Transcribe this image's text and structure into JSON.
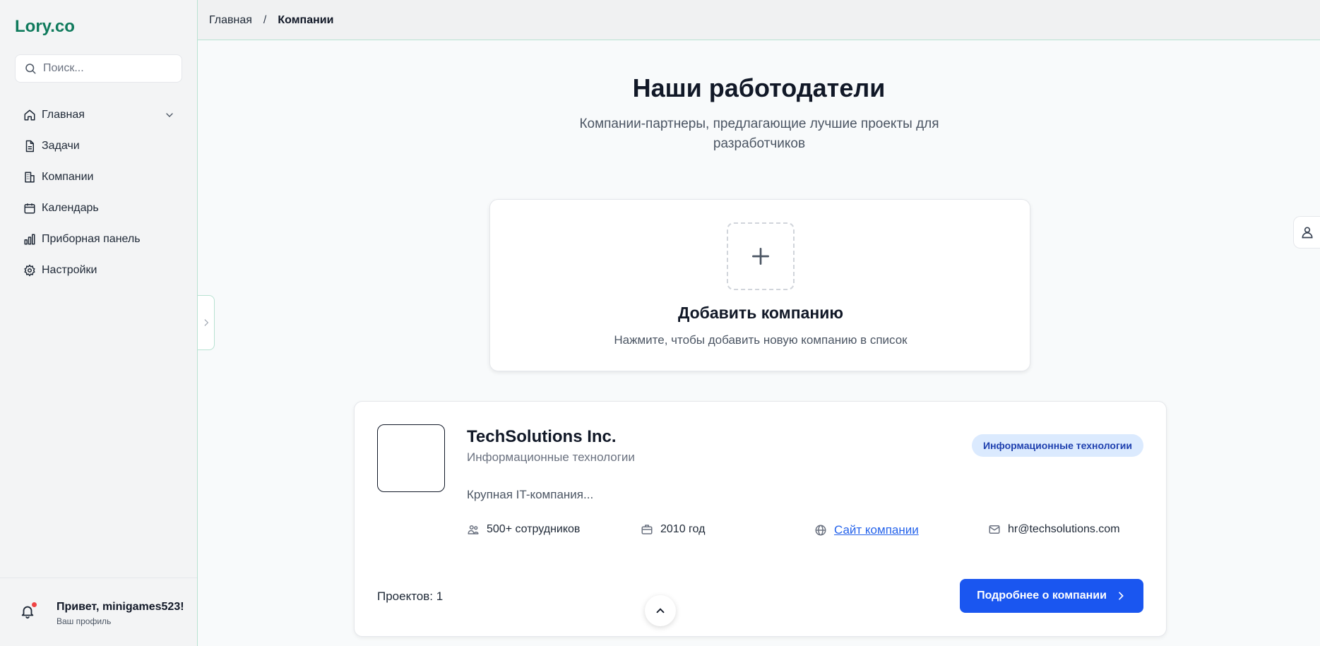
{
  "app": {
    "logo": "Lory.co"
  },
  "search": {
    "placeholder": "Поиск..."
  },
  "sidebar": {
    "items": [
      {
        "label": "Главная",
        "icon": "home-icon"
      },
      {
        "label": "Задачи",
        "icon": "document-icon"
      },
      {
        "label": "Компании",
        "icon": "building-icon"
      },
      {
        "label": "Календарь",
        "icon": "calendar-icon"
      },
      {
        "label": "Приборная панель",
        "icon": "bar-chart-icon"
      },
      {
        "label": "Настройки",
        "icon": "gear-icon"
      }
    ]
  },
  "user": {
    "greeting": "Привет, minigames523!",
    "profile_link": "Ваш профиль",
    "has_notification": true
  },
  "breadcrumb": {
    "home": "Главная",
    "separator": "/",
    "current": "Компании"
  },
  "main": {
    "title": "Наши работодатели",
    "subtitle": "Компании-партнеры, предлагающие лучшие проекты для разработчиков"
  },
  "add_company": {
    "title": "Добавить компанию",
    "description": "Нажмите, чтобы добавить новую компанию в список"
  },
  "companies": [
    {
      "name": "TechSolutions Inc.",
      "industry": "Информационные технологии",
      "badge": "Информационные технологии",
      "description": "Крупная IT-компания...",
      "employees": "500+ сотрудников",
      "founded": "2010 год",
      "website_label": "Сайт компании",
      "email": "hr@techsolutions.com",
      "projects_label": "Проектов:",
      "projects_count": "1",
      "details_button": "Подробнее о компании"
    }
  ],
  "colors": {
    "brand": "#0f7a5c",
    "primary_button": "#1a56f0",
    "badge_bg": "#dbeafe",
    "badge_text": "#1e40af",
    "link": "#2563eb",
    "notification_dot": "#ef4444"
  }
}
